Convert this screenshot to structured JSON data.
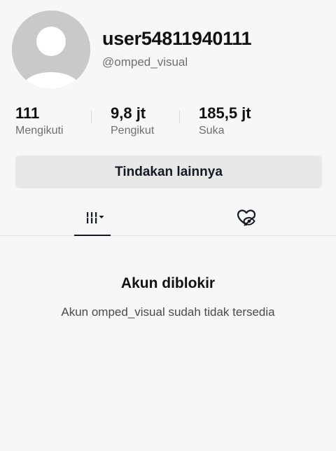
{
  "profile": {
    "username": "user54811940111",
    "handle": "@omped_visual"
  },
  "stats": [
    {
      "value": "111",
      "label": "Mengikuti"
    },
    {
      "value": "9,8 jt",
      "label": "Pengikut"
    },
    {
      "value": "185,5 jt",
      "label": "Suka"
    }
  ],
  "actions": {
    "more_label": "Tindakan lainnya"
  },
  "tabs": [
    {
      "icon": "video-grid-dropdown-icon",
      "active": true
    },
    {
      "icon": "liked-videos-hidden-icon",
      "active": false
    }
  ],
  "blocked": {
    "title": "Akun diblokir",
    "description": "Akun omped_visual sudah tidak tersedia"
  }
}
